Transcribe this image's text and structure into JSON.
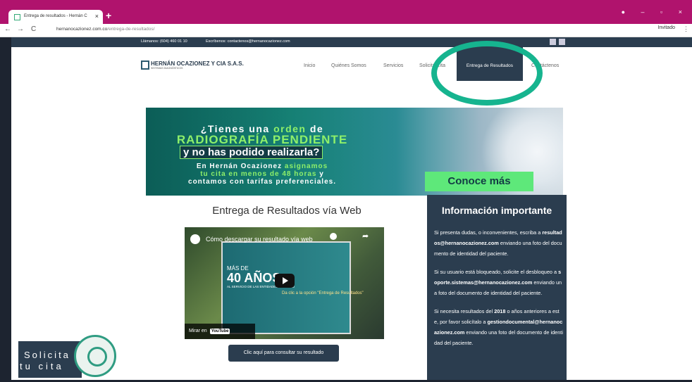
{
  "browser": {
    "tab_title": "Entrega de resultados - Hernán C",
    "tab_close": "×",
    "new_tab": "+",
    "url_host": "hernanocazionez.com.co",
    "url_path": "/entrega-de-resultados/",
    "profile": "Invitado",
    "nav_back": "←",
    "nav_forward": "→",
    "nav_reload": "C",
    "window_controls": "● – ▫ ×",
    "menu": "⋮"
  },
  "topbar": {
    "phone": "Llámanos: (604) 460 01 10",
    "email": "Escríbenos: contactenos@hernanocazionez.com"
  },
  "header": {
    "logo_name": "HERNÁN OCAZIONEZ Y CIA S.A.S.",
    "logo_sub": "SISTEMAS DIAGNÓSTICOS",
    "nav": {
      "inicio": "Inicio",
      "quienes": "Quiénes Somos",
      "servicios": "Servicios",
      "solicita": "Solicita Cita",
      "entrega": "Entrega de Resultados",
      "contactenos": "Contáctenos"
    }
  },
  "banner": {
    "line1a": "¿Tienes una",
    "line1b": "orden",
    "line1c": "de",
    "line2": "RADIOGRAFÍA PENDIENTE",
    "line3": "y no has podido realizarla?",
    "line4a": "En Hernán Ocazionez",
    "line4b": "asignamos",
    "line5a": "tu cita en menos de 48 horas",
    "line5b": "y",
    "line6": "contamos con tarifas preferenciales.",
    "button": "Conoce más"
  },
  "main": {
    "heading": "Entrega de Resultados vía Web",
    "video": {
      "title": "Cómo descargar su resultado vía web",
      "mas_de": "MÁS DE",
      "years": "40 AÑOS",
      "servicio": "AL SERVICIO DE LAS ENTIDADES DE SALUD",
      "click_hint": "Da clic a la opción \"Entrega de Resultados\"",
      "watch_on": "Mirar en",
      "youtube": "YouTube"
    },
    "consult_button": "Clic aquí para consultar su resultado"
  },
  "info": {
    "title": "Información importante",
    "p1_pre": "Si presenta dudas, o inconvenientes, escriba a",
    "p1_email": "resultados@hernanocazionez.com",
    "p1_post": "enviando una foto del documento de identidad del paciente.",
    "p2_pre": "Si su usuario está bloqueado, solicite el desbloqueo a",
    "p2_email": "soporte.sistemas@hernanocazionez.com",
    "p2_post": "enviando una foto del documento de identidad del paciente.",
    "p3_pre": "Si necesita resultados del",
    "p3_year": "2018",
    "p3_mid": "o años anteriores a este, por favor solicítalo a",
    "p3_email": "gestiondocumental@hernanocazionez.com",
    "p3_post": "enviando una foto del documento de identidad del paciente."
  },
  "floating": {
    "line1": "Solicita",
    "line2": "tu cita"
  },
  "colors": {
    "tabbar": "#b0136d",
    "navy": "#2b3d4f",
    "highlight_circle": "#16b48f",
    "banner_green": "#8ef06a"
  }
}
